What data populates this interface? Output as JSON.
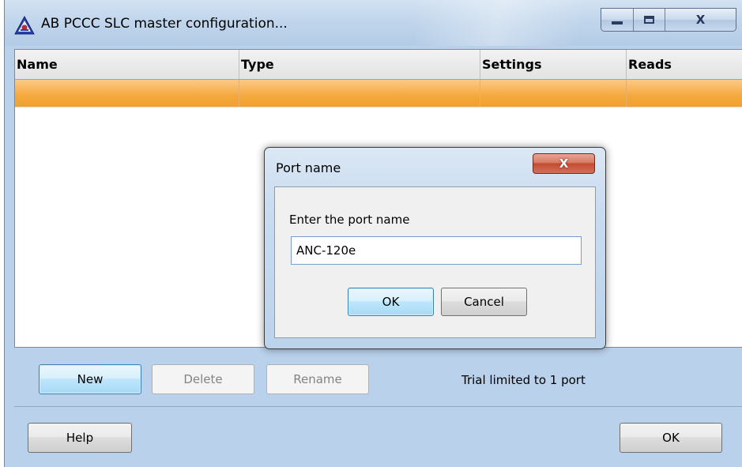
{
  "window": {
    "title": "AB PCCC SLC master configuration...",
    "close_glyph": "X"
  },
  "table": {
    "columns": [
      "Name",
      "Type",
      "Settings",
      "Reads"
    ],
    "rows": [
      {
        "name": "",
        "type": "",
        "settings": "",
        "reads": "",
        "selected": true
      }
    ]
  },
  "toolbar": {
    "new_label": "New",
    "delete_label": "Delete",
    "rename_label": "Rename",
    "trial_text": "Trial limited to 1 port"
  },
  "footer": {
    "help_label": "Help",
    "ok_label": "OK"
  },
  "dialog": {
    "title": "Port name",
    "close_glyph": "X",
    "prompt": "Enter the port name",
    "input_value": "ANC-120e",
    "ok_label": "OK",
    "cancel_label": "Cancel"
  },
  "colors": {
    "selection_row": "#f5a93c",
    "title_bar": "#c1d6ec",
    "window_bg": "#b9d1ea",
    "close_button": "#c44c30",
    "default_button": "#bee6fd"
  },
  "icons": [
    "app-logo-icon",
    "minimize-icon",
    "maximize-icon",
    "close-icon",
    "dialog-close-icon"
  ]
}
